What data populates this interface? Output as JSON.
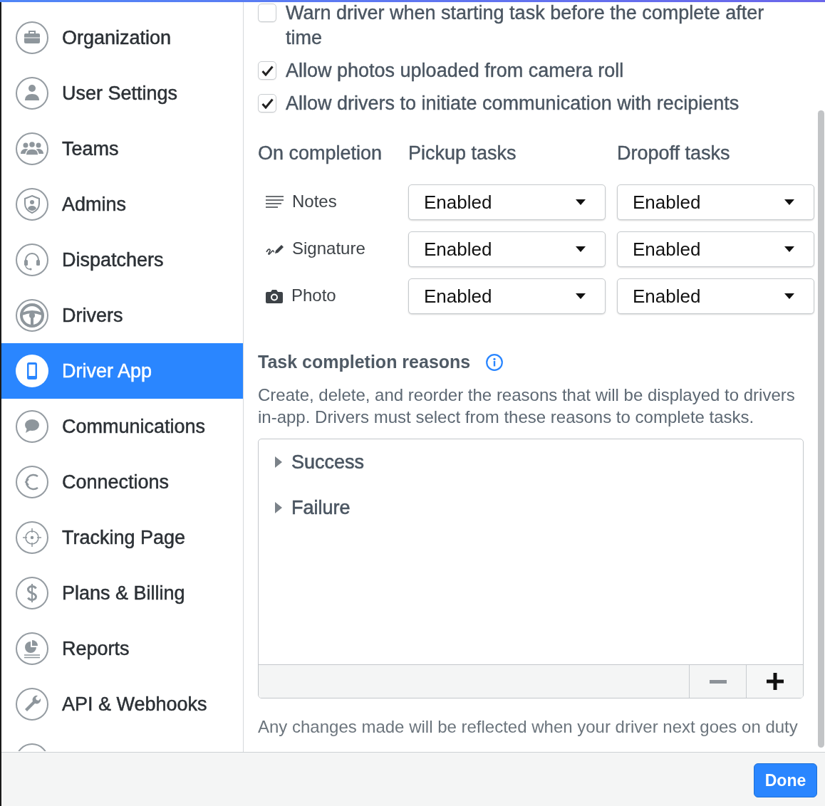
{
  "sidebar": {
    "items": [
      {
        "label": "Organization",
        "selected": false
      },
      {
        "label": "User Settings",
        "selected": false
      },
      {
        "label": "Teams",
        "selected": false
      },
      {
        "label": "Admins",
        "selected": false
      },
      {
        "label": "Dispatchers",
        "selected": false
      },
      {
        "label": "Drivers",
        "selected": false
      },
      {
        "label": "Driver App",
        "selected": true
      },
      {
        "label": "Communications",
        "selected": false
      },
      {
        "label": "Connections",
        "selected": false
      },
      {
        "label": "Tracking Page",
        "selected": false
      },
      {
        "label": "Plans & Billing",
        "selected": false
      },
      {
        "label": "Reports",
        "selected": false
      },
      {
        "label": "API & Webhooks",
        "selected": false
      }
    ]
  },
  "options": [
    {
      "label": "Warn driver when starting task before the complete after time",
      "checked": false
    },
    {
      "label": "Allow photos uploaded from camera roll",
      "checked": true
    },
    {
      "label": "Allow drivers to initiate communication with recipients",
      "checked": true
    }
  ],
  "completion": {
    "columns": [
      "On completion",
      "Pickup tasks",
      "Dropoff tasks"
    ],
    "rows": [
      {
        "label": "Notes",
        "pickup": "Enabled",
        "dropoff": "Enabled"
      },
      {
        "label": "Signature",
        "pickup": "Enabled",
        "dropoff": "Enabled"
      },
      {
        "label": "Photo",
        "pickup": "Enabled",
        "dropoff": "Enabled"
      }
    ]
  },
  "reasons": {
    "title": "Task completion reasons",
    "description": "Create, delete, and reorder the reasons that will be displayed to drivers in-app. Drivers must select from these reasons to complete tasks.",
    "groups": [
      {
        "label": "Success",
        "expanded": false
      },
      {
        "label": "Failure",
        "expanded": false
      }
    ],
    "controls": [
      {
        "kind": "remove",
        "disabled": true
      },
      {
        "kind": "add",
        "disabled": false
      }
    ]
  },
  "note": "Any changes made will be reflected when your driver next goes on duty",
  "footer": {
    "button": "Done"
  }
}
